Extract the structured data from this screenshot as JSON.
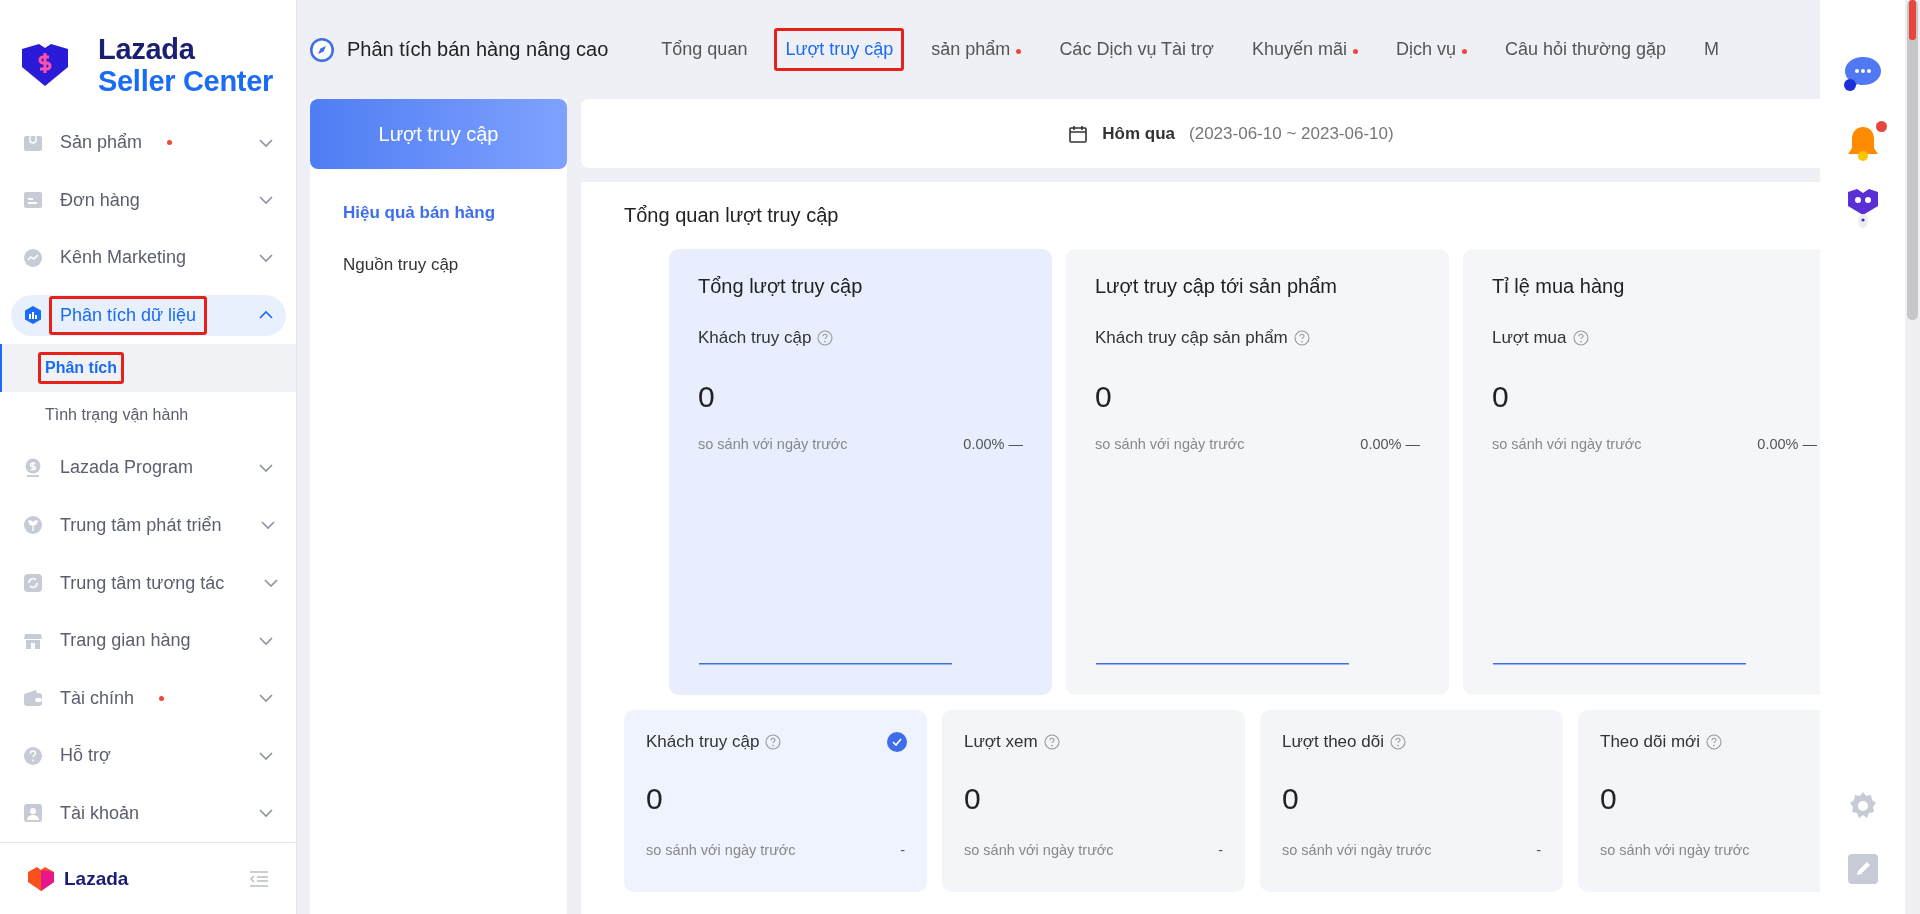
{
  "sidebar": {
    "logo": {
      "line1": "Lazada",
      "line2": "Seller Center"
    },
    "items": [
      {
        "label": "Sản phẩm",
        "kind": "box",
        "dot": true,
        "expanded": false,
        "selected": false,
        "annotated": false
      },
      {
        "label": "Đơn hàng",
        "kind": "order",
        "dot": false,
        "expanded": false,
        "selected": false,
        "annotated": false
      },
      {
        "label": "Kênh Marketing",
        "kind": "trend",
        "dot": false,
        "expanded": false,
        "selected": false,
        "annotated": false
      },
      {
        "label": "Phân tích dữ liệu",
        "kind": "bars",
        "dot": false,
        "expanded": true,
        "selected": true,
        "annotated": true,
        "children": [
          {
            "label": "Phân tích",
            "selected": true,
            "annotated": true
          },
          {
            "label": "Tình trạng vận hành",
            "selected": false,
            "annotated": false
          }
        ]
      },
      {
        "label": "Lazada Program",
        "kind": "dollar",
        "dot": false,
        "expanded": false,
        "selected": false,
        "annotated": false
      },
      {
        "label": "Trung tâm phát triển",
        "kind": "sprout",
        "dot": false,
        "expanded": false,
        "selected": false,
        "annotated": false
      },
      {
        "label": "Trung tâm tương tác",
        "kind": "cycle",
        "dot": false,
        "expanded": false,
        "selected": false,
        "annotated": false
      },
      {
        "label": "Trang gian hàng",
        "kind": "store",
        "dot": false,
        "expanded": false,
        "selected": false,
        "annotated": false
      },
      {
        "label": "Tài chính",
        "kind": "wallet",
        "dot": true,
        "expanded": false,
        "selected": false,
        "annotated": false
      },
      {
        "label": "Hỗ trợ",
        "kind": "help",
        "dot": false,
        "expanded": false,
        "selected": false,
        "annotated": false
      },
      {
        "label": "Tài khoản",
        "kind": "user",
        "dot": false,
        "expanded": false,
        "selected": false,
        "annotated": false
      }
    ],
    "footer": {
      "brand": "Lazada"
    }
  },
  "header": {
    "title": "Phân tích bán hàng nâng cao",
    "tabs": [
      {
        "label": "Tổng quan",
        "selected": false,
        "dot": false,
        "annotated": false
      },
      {
        "label": "Lượt truy cập",
        "selected": true,
        "dot": false,
        "annotated": true
      },
      {
        "label": "sản phẩm",
        "selected": false,
        "dot": true,
        "annotated": false
      },
      {
        "label": "Các Dịch vụ Tài trợ",
        "selected": false,
        "dot": false,
        "annotated": false
      },
      {
        "label": "Khuyến mãi",
        "selected": false,
        "dot": true,
        "annotated": false
      },
      {
        "label": "Dịch vụ",
        "selected": false,
        "dot": true,
        "annotated": false
      },
      {
        "label": "Câu hỏi thường gặp",
        "selected": false,
        "dot": false,
        "annotated": false
      },
      {
        "label": "M",
        "selected": false,
        "dot": false,
        "annotated": false
      }
    ]
  },
  "subnav": {
    "title": "Lượt truy cập",
    "items": [
      {
        "label": "Hiệu quả bán hàng",
        "selected": true
      },
      {
        "label": "Nguồn truy cập",
        "selected": false
      }
    ]
  },
  "date_bar": {
    "label": "Hôm qua",
    "range": "(2023-06-10 ~ 2023-06-10)"
  },
  "overview": {
    "title": "Tổng quan lượt truy cập",
    "big_cards": [
      {
        "title": "Tổng lượt truy cập",
        "metric": "Khách truy cập",
        "value": "0",
        "compare": "so sánh với ngày trước",
        "change": "0.00%",
        "trend": "—",
        "selected": true
      },
      {
        "title": "Lượt truy cập tới sản phẩm",
        "metric": "Khách truy cập sản phẩm",
        "value": "0",
        "compare": "so sánh với ngày trước",
        "change": "0.00%",
        "trend": "—",
        "selected": false
      },
      {
        "title": "Tỉ lệ mua hàng",
        "metric": "Lượt mua",
        "value": "0",
        "compare": "so sánh với ngày trước",
        "change": "0.00%",
        "trend": "—",
        "selected": false
      }
    ],
    "small_cards": [
      {
        "label": "Khách truy cập",
        "value": "0",
        "compare": "so sánh với ngày trước",
        "change": "-",
        "selected": true
      },
      {
        "label": "Lượt xem",
        "value": "0",
        "compare": "so sánh với ngày trước",
        "change": "-",
        "selected": false
      },
      {
        "label": "Lượt theo dõi",
        "value": "0",
        "compare": "so sánh với ngày trước",
        "change": "-",
        "selected": false
      },
      {
        "label": "Theo dõi mới",
        "value": "0",
        "compare": "so sánh với ngày trước",
        "selected": false
      }
    ]
  },
  "right_rail": {
    "notification_dot": true
  }
}
